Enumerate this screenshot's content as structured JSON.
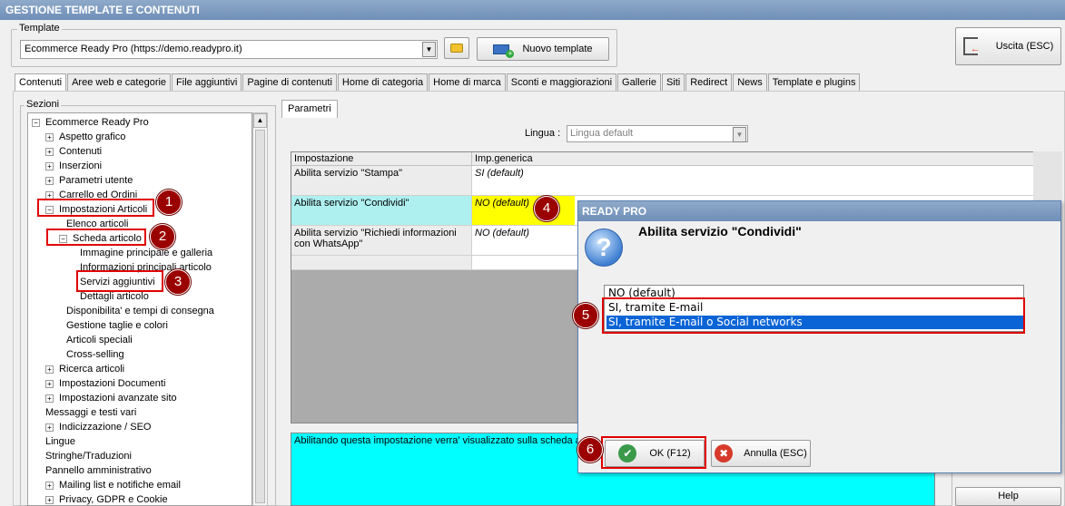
{
  "window": {
    "title": "GESTIONE TEMPLATE E CONTENUTI"
  },
  "template": {
    "legend": "Template",
    "selected": "Ecommerce Ready Pro (https://demo.readypro.it)",
    "new_button": "Nuovo template",
    "exit_button": "Uscita (ESC)"
  },
  "tabs": [
    "Contenuti",
    "Aree web e categorie",
    "File aggiuntivi",
    "Pagine di contenuti",
    "Home di categoria",
    "Home di marca",
    "Sconti e maggiorazioni",
    "Gallerie",
    "Siti",
    "Redirect",
    "News",
    "Template e plugins"
  ],
  "sections": {
    "legend": "Sezioni",
    "tree": [
      {
        "label": "Ecommerce Ready Pro",
        "exp": "−",
        "level": 0
      },
      {
        "label": "Aspetto grafico",
        "exp": "+",
        "level": 1
      },
      {
        "label": "Contenuti",
        "exp": "+",
        "level": 1
      },
      {
        "label": "Inserzioni",
        "exp": "+",
        "level": 1
      },
      {
        "label": "Parametri utente",
        "exp": "+",
        "level": 1
      },
      {
        "label": "Carrello ed Ordini",
        "exp": "+",
        "level": 1
      },
      {
        "label": "Impostazioni Articoli",
        "exp": "−",
        "level": 1
      },
      {
        "label": "Elenco articoli",
        "exp": "",
        "level": 2
      },
      {
        "label": "Scheda articolo",
        "exp": "−",
        "level": 2
      },
      {
        "label": "Immagine principale e galleria",
        "exp": "",
        "level": 3
      },
      {
        "label": "Informazioni principali articolo",
        "exp": "",
        "level": 3
      },
      {
        "label": "Servizi aggiuntivi",
        "exp": "",
        "level": 3
      },
      {
        "label": "Dettagli articolo",
        "exp": "",
        "level": 3
      },
      {
        "label": "Disponibilita' e tempi di consegna",
        "exp": "",
        "level": 2
      },
      {
        "label": "Gestione taglie e colori",
        "exp": "",
        "level": 2
      },
      {
        "label": "Articoli speciali",
        "exp": "",
        "level": 2
      },
      {
        "label": "Cross-selling",
        "exp": "",
        "level": 2
      },
      {
        "label": "Ricerca articoli",
        "exp": "+",
        "level": 1
      },
      {
        "label": "Impostazioni Documenti",
        "exp": "+",
        "level": 1
      },
      {
        "label": "Impostazioni avanzate sito",
        "exp": "+",
        "level": 1
      },
      {
        "label": "Messaggi e testi vari",
        "exp": "",
        "level": 1
      },
      {
        "label": "Indicizzazione / SEO",
        "exp": "+",
        "level": 1
      },
      {
        "label": "Lingue",
        "exp": "",
        "level": 1
      },
      {
        "label": "Stringhe/Traduzioni",
        "exp": "",
        "level": 1
      },
      {
        "label": "Pannello amministrativo",
        "exp": "",
        "level": 1
      },
      {
        "label": "Mailing list e notifiche email",
        "exp": "+",
        "level": 1
      },
      {
        "label": "Privacy, GDPR e Cookie",
        "exp": "+",
        "level": 1
      }
    ]
  },
  "params": {
    "tab": "Parametri",
    "lingua_label": "Lingua :",
    "lingua_value": "Lingua default",
    "headers": [
      "Impostazione",
      "Imp.generica"
    ],
    "rows": [
      {
        "setting": "Abilita servizio \"Stampa\"",
        "value": "SI (default)"
      },
      {
        "setting": "Abilita servizio \"Condividi\"",
        "value": "NO (default)"
      },
      {
        "setting": "Abilita servizio \"Richiedi informazioni con WhatsApp\"",
        "value": "NO (default)"
      }
    ],
    "description": "Abilitando questa impostazione verra' visualizzato sulla scheda art",
    "help": "Help"
  },
  "dialog": {
    "title": "READY PRO",
    "heading": "Abilita servizio \"Condividi\"",
    "options": [
      "NO (default)",
      "SI, tramite E-mail",
      "SI, tramite E-mail o Social networks"
    ],
    "selected_index": 2,
    "ok": "OK (F12)",
    "cancel": "Annulla (ESC)"
  },
  "badges": [
    "1",
    "2",
    "3",
    "4",
    "5",
    "6"
  ],
  "colors": {
    "highlight": "#ffff00",
    "selected_row": "#aef0f0",
    "description_bg": "#00ffff",
    "selection": "#0a64d6",
    "annotation": "#e00000"
  }
}
